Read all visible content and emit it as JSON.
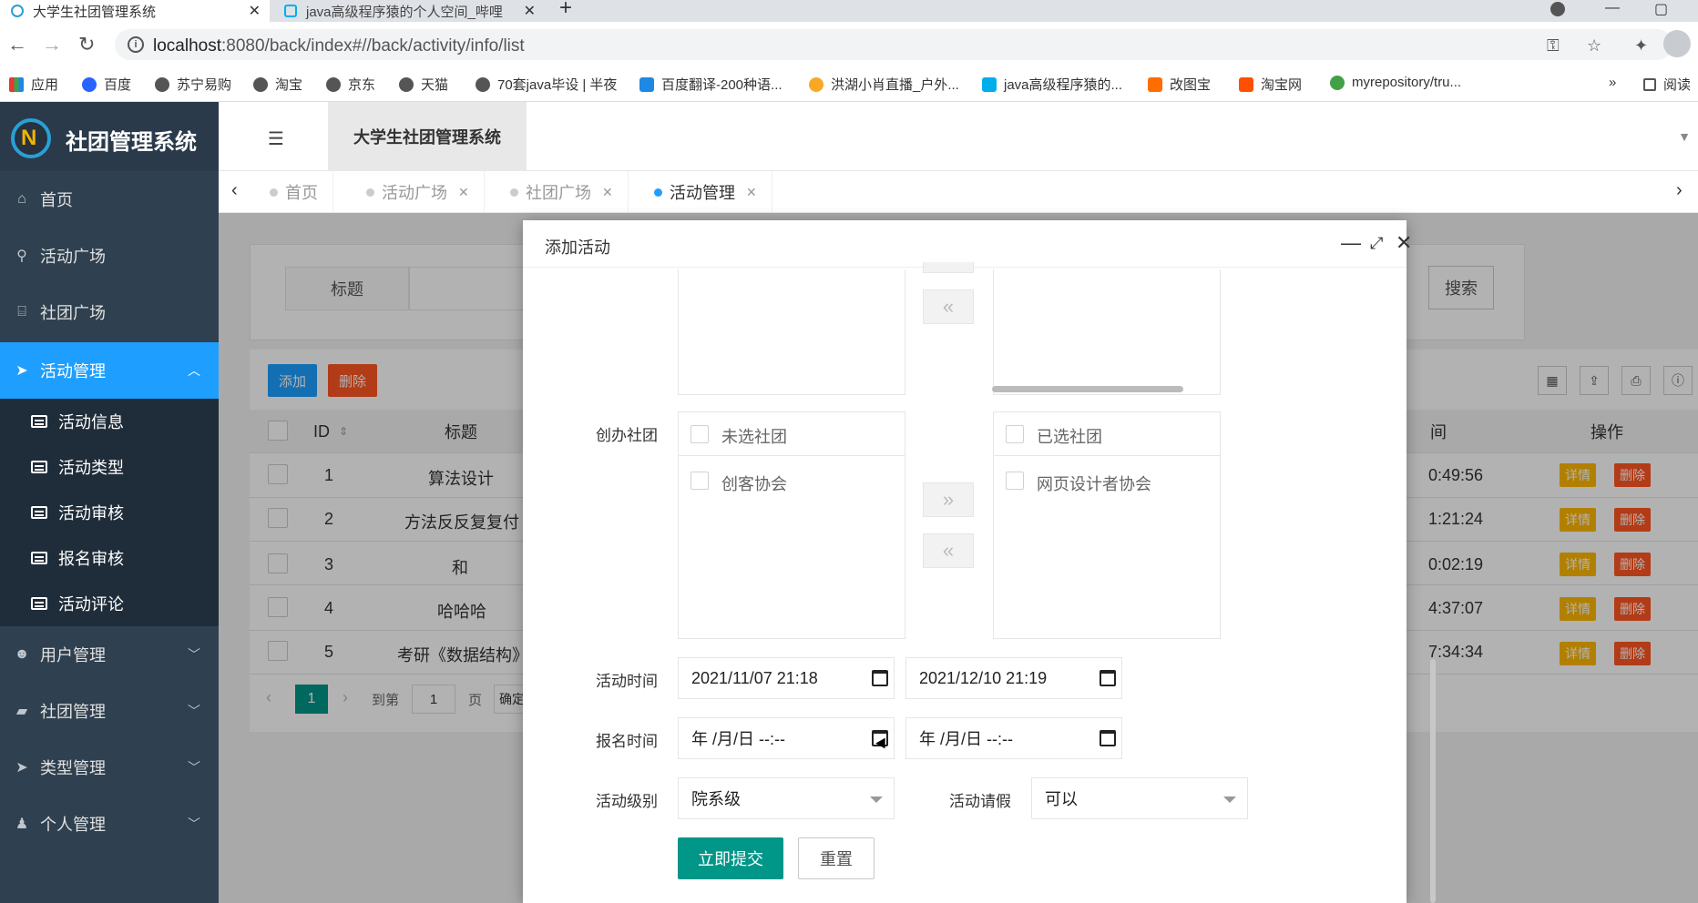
{
  "browser": {
    "tabs": [
      {
        "title": "大学生社团管理系统"
      },
      {
        "title": "java高级程序猿的个人空间_哔哩"
      }
    ],
    "url_host": "localhost",
    "url_rest": ":8080/back/index#//back/activity/info/list",
    "bookmarks": [
      {
        "label": "应用",
        "color": "#e53935"
      },
      {
        "label": "百度",
        "color": "#2962ff"
      },
      {
        "label": "苏宁易购",
        "color": "#555555"
      },
      {
        "label": "淘宝",
        "color": "#555555"
      },
      {
        "label": "京东",
        "color": "#555555"
      },
      {
        "label": "天猫",
        "color": "#555555"
      },
      {
        "label": "70套java毕设 | 半夜",
        "color": "#555555"
      },
      {
        "label": "百度翻译-200种语...",
        "color": "#1e88e5"
      },
      {
        "label": "洪湖小肖直播_户外...",
        "color": "#f9a825"
      },
      {
        "label": "java高级程序猿的...",
        "color": "#00aeec"
      },
      {
        "label": "改图宝",
        "color": "#ff6d00"
      },
      {
        "label": "淘宝网",
        "color": "#ff5000"
      },
      {
        "label": "myrepository/tru...",
        "color": "#43a047"
      }
    ],
    "more": "»",
    "reading": "阅读"
  },
  "app": {
    "logo_letter": "N",
    "title": "社团管理系统",
    "header_title": "大学生社团管理系统"
  },
  "sidebar": {
    "items": [
      {
        "label": "首页",
        "icon": "home-icon"
      },
      {
        "label": "活动广场",
        "icon": "bike-icon"
      },
      {
        "label": "社团广场",
        "icon": "bank-icon"
      },
      {
        "label": "活动管理",
        "icon": "send-icon"
      },
      {
        "label": "用户管理",
        "icon": "users-icon"
      },
      {
        "label": "社团管理",
        "icon": "book-icon"
      },
      {
        "label": "类型管理",
        "icon": "send-icon"
      },
      {
        "label": "个人管理",
        "icon": "user-icon"
      }
    ],
    "sub_items": [
      {
        "label": "活动信息"
      },
      {
        "label": "活动类型"
      },
      {
        "label": "活动审核"
      },
      {
        "label": "报名审核"
      },
      {
        "label": "活动评论"
      }
    ]
  },
  "page_tabs": [
    {
      "label": "首页"
    },
    {
      "label": "活动广场"
    },
    {
      "label": "社团广场"
    },
    {
      "label": "活动管理"
    }
  ],
  "search": {
    "label": "标题",
    "button": "搜索"
  },
  "toolbar": {
    "add": "添加",
    "delete": "删除"
  },
  "table": {
    "headers": {
      "id": "ID",
      "title": "标题",
      "time": "间",
      "ops": "操作"
    },
    "rows": [
      {
        "id": "1",
        "title": "算法设计",
        "time": "0:49:56"
      },
      {
        "id": "2",
        "title": "方法反反复复付",
        "time": "1:21:24"
      },
      {
        "id": "3",
        "title": "和",
        "time": "0:02:19"
      },
      {
        "id": "4",
        "title": "哈哈哈",
        "time": "4:37:07"
      },
      {
        "id": "5",
        "title": "考研《数据结构》",
        "time": "7:34:34"
      }
    ],
    "detail_label": "详情",
    "delete_label": "删除"
  },
  "pager": {
    "current": "1",
    "goto": "到第",
    "page_value": "1",
    "page_suffix": "页",
    "confirm": "确定"
  },
  "dialog": {
    "title": "添加活动",
    "transfer_label": "创办社团",
    "left_title": "未选社团",
    "left_items": [
      "创客协会"
    ],
    "right_title": "已选社团",
    "right_items": [
      "网页设计者协会"
    ],
    "to_right": "»",
    "to_left": "«",
    "activity_time_label": "活动时间",
    "activity_start": "2021/11/07 21:18",
    "activity_end": "2021/12/10 21:19",
    "signup_time_label": "报名时间",
    "signup_start": "年 /月/日 --:--",
    "signup_end": "年 /月/日 --:--",
    "level_label": "活动级别",
    "level_value": "院系级",
    "leave_label": "活动请假",
    "leave_value": "可以",
    "submit": "立即提交",
    "reset": "重置"
  }
}
